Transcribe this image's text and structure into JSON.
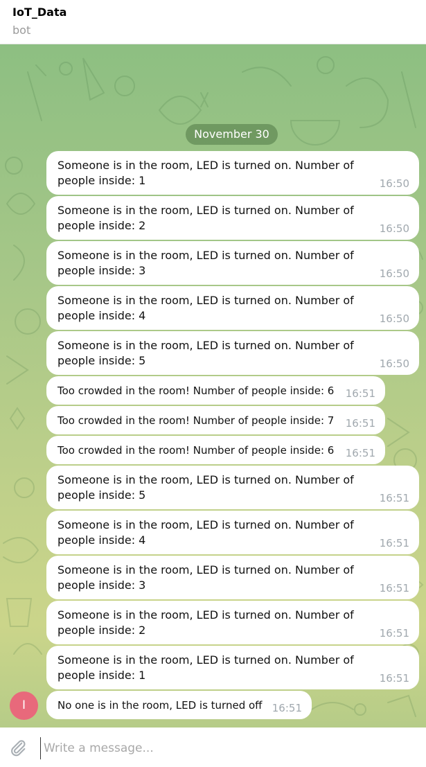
{
  "header": {
    "title": "IoT_Data",
    "subtitle": "bot"
  },
  "chat": {
    "date": "November 30",
    "messages": [
      {
        "text": "Someone is in the room, LED is turned on. Number of people inside: 1",
        "time": "16:50"
      },
      {
        "text": "Someone is in the room, LED is turned on. Number of people inside: 2",
        "time": "16:50"
      },
      {
        "text": "Someone is in the room, LED is turned on. Number of people inside: 3",
        "time": "16:50"
      },
      {
        "text": "Someone is in the room, LED is turned on. Number of people inside: 4",
        "time": "16:50"
      },
      {
        "text": "Someone is in the room, LED is turned on. Number of people inside: 5",
        "time": "16:50"
      },
      {
        "text": "Too crowded in the room! Number of people inside: 6",
        "time": "16:51"
      },
      {
        "text": "Too crowded in the room! Number of people inside: 7",
        "time": "16:51"
      },
      {
        "text": "Too crowded in the room! Number of people inside: 6",
        "time": "16:51"
      },
      {
        "text": "Someone is in the room, LED is turned on. Number of people inside: 5",
        "time": "16:51"
      },
      {
        "text": "Someone is in the room, LED is turned on. Number of people inside: 4",
        "time": "16:51"
      },
      {
        "text": "Someone is in the room, LED is turned on. Number of people inside: 3",
        "time": "16:51"
      },
      {
        "text": "Someone is in the room, LED is turned on. Number of people inside: 2",
        "time": "16:51"
      },
      {
        "text": "Someone is in the room, LED is turned on. Number of people inside: 1",
        "time": "16:51"
      },
      {
        "text": "No one is in the room, LED is turned off",
        "time": "16:51"
      }
    ]
  },
  "avatar": {
    "initial": "I",
    "color": "#e8697b"
  },
  "composer": {
    "placeholder": "Write a message...",
    "icon": "paperclip-icon"
  }
}
